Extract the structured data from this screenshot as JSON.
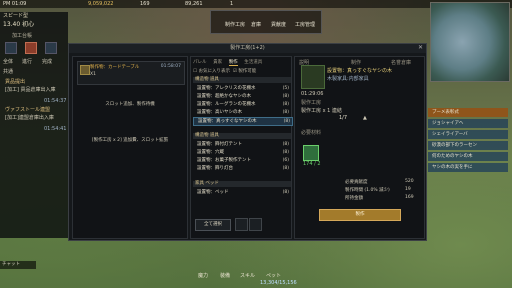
{
  "topbar": {
    "time": "PM 01:09",
    "silver": "9,059,022",
    "contribution": "169",
    "count2": "89,261",
    "count3": "1",
    "menu1": "制作工房",
    "menu2": "倉庫",
    "menu3": "貢献度",
    "menu4": "工房管理"
  },
  "hud": {
    "speed_label": "スピード型",
    "speed_value": "13.40 初心",
    "panel_title": "加工台帳",
    "side_tab1": "全体",
    "side_tab2": "進行",
    "side_tab3": "完成",
    "side_tab4": "共通",
    "side_entry1": "貢品提出",
    "side_entry2": "[加工] 貢品倉庫出入庫",
    "side_time1": "01:54:37",
    "side_entry3": "ヴァフストール連盟",
    "side_entry4": "[加工]連盟倉庫出入庫",
    "side_time2": "01:54:41",
    "chat": "チャット"
  },
  "dialog": {
    "title": "製作工房(1+2)",
    "panel_a": {
      "card1_title": "製作物：カードテーブル",
      "card1_qty": "X1",
      "card1_time": "01:58:07",
      "slot_line1": "スロット追加、製作待機",
      "slot_line2": "[製作工房 x 2] 追加費、スロット拡張"
    },
    "panel_b": {
      "tabs": [
        "パレル",
        "貴家",
        "製作",
        "生活道具"
      ],
      "active_tab": "製作",
      "filter1": "お気に入り表示",
      "filter2": "製作可能",
      "categories": [
        {
          "name": "構造物 道具",
          "items": [
            {
              "name": "設置物：アレクリスの花棚水",
              "count": "(5)"
            },
            {
              "name": "設置物：超絶かなヤシの木",
              "count": "(8)"
            },
            {
              "name": "設置物：ルーグランの花棚水",
              "count": "(8)"
            },
            {
              "name": "設置物：高いヤシの木",
              "count": "(8)"
            },
            {
              "name": "設置物：真っすぐなヤシの木",
              "count": "(8)"
            }
          ]
        },
        {
          "name": "構造物 道具",
          "items": [
            {
              "name": "設置物：飾付灯テント",
              "count": "(8)"
            },
            {
              "name": "設置物：穴蔵",
              "count": "(8)"
            },
            {
              "name": "設置物：お菓子製作テント",
              "count": "(6)"
            },
            {
              "name": "設置物：飾り灯台",
              "count": "(8)"
            }
          ]
        },
        {
          "name": "家具 ベッド",
          "items": [
            {
              "name": "設置物：ベッド",
              "count": "(8)"
            }
          ]
        }
      ],
      "btn_all": "全て選択"
    },
    "panel_c": {
      "tab_left": "説明",
      "tab_mid": "制作",
      "tab_right": "名誉倉庫",
      "product_name": "設置物：真っすぐなヤシの木",
      "product_sub": "木製家具:内部家具",
      "craft_time": "01:29:06",
      "craft_type": "製作工房",
      "craft_type_value": "製作工房 x 1 連結",
      "qty": "1/7",
      "materials_label": "必要材料",
      "material_count": "174 / 2",
      "info1_label": "必要貢献度",
      "info1_value": "520",
      "info2_label": "製作時間 (1.0% 減少)",
      "info2_value": "19",
      "info3_label": "所持金額",
      "info3_value": "169",
      "craft_button": "製作"
    }
  },
  "quests": [
    {
      "label": "ブーメ表彰式",
      "accent": "#9a5418"
    },
    {
      "label": "ジョシャイアヘ",
      "accent": "#1f4c72"
    },
    {
      "label": "シェイライアーバ",
      "accent": "#1f4c72"
    },
    {
      "label": "砂漠の部下のラーセン",
      "accent": "#1f4c72"
    },
    {
      "label": "何のためのヤシの木",
      "accent": "#1f4c72"
    },
    {
      "label": "ヤシの木の実を手に",
      "accent": "#1f4c72"
    }
  ],
  "bottom": {
    "stamina": "13,304/15,156",
    "slot_labels": [
      "魔力",
      "装備",
      "スキル",
      "ペット"
    ]
  }
}
